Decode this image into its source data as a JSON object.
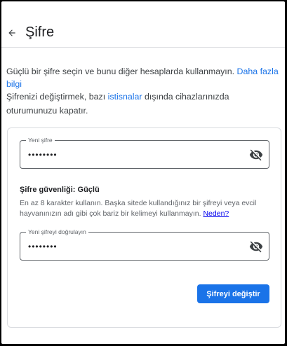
{
  "header": {
    "title": "Şifre"
  },
  "intro": {
    "text": "Güçlü bir şifre seçin ve bunu diğer hesaplarda kullanmayın. ",
    "link": "Daha fazla bilgi"
  },
  "note": {
    "text_before": "Şifrenizi değiştirmek, bazı ",
    "link": "istisnalar",
    "text_after": " dışında cihazlarınızda oturumunuzu kapatır."
  },
  "new_password": {
    "label": "Yeni şifre",
    "value": "••••••••"
  },
  "strength": {
    "title": "Şifre güvenliği: Güçlü",
    "text": "En az 8 karakter kullanın. Başka sitede kullandığınız bir şifreyi veya evcil hayvanınızın adı gibi çok bariz bir kelimeyi kullanmayın. ",
    "link": "Neden?"
  },
  "confirm_password": {
    "label": "Yeni şifreyi doğrulayın",
    "value": "••••••••"
  },
  "submit": {
    "label": "Şifreyi değiştir"
  },
  "icons": {
    "back": "arrow-back-icon",
    "visibility": "visibility-off-icon"
  },
  "colors": {
    "link": "#1a73e8",
    "primary_button": "#1a73e8",
    "border": "#dadce0"
  }
}
